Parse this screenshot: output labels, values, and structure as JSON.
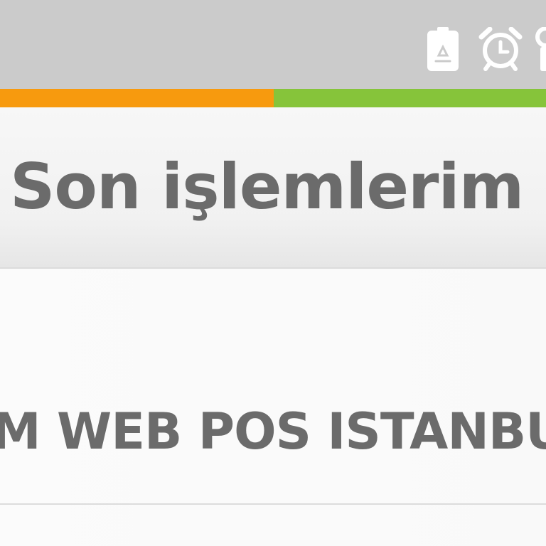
{
  "status_bar": {
    "icons": [
      "battery-saver-icon",
      "alarm-clock-icon"
    ]
  },
  "colors": {
    "status_bar_bg": "#cbcbcb",
    "accent_left": "#f79a0e",
    "accent_right": "#86c43a",
    "title_text": "#6b6b6b"
  },
  "header": {
    "title": "Son işlemlerim"
  },
  "transactions": [
    {
      "merchant": "M WEB POS ISTANBU"
    }
  ]
}
